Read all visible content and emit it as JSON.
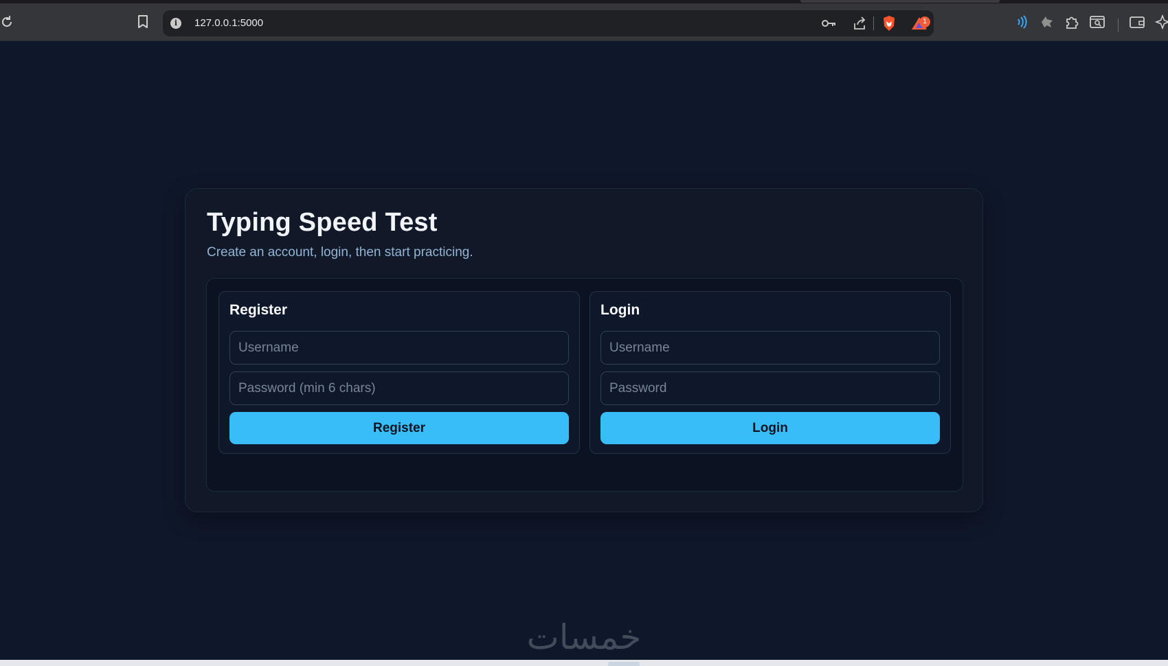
{
  "browser": {
    "url": "127.0.0.1:5000",
    "notification_count": "1",
    "icons": [
      "reload-icon",
      "bookmark-icon",
      "site-info-icon",
      "password-key-icon",
      "share-icon",
      "brave-shield-icon",
      "brave-rewards-icon",
      "speech-icon",
      "wolf-extension-icon",
      "extensions-puzzle-icon",
      "reader-mode-icon",
      "wallet-icon",
      "leo-ai-icon"
    ]
  },
  "page": {
    "title": "Typing Speed Test",
    "subtitle": "Create an account, login, then start practicing."
  },
  "register": {
    "heading": "Register",
    "username_placeholder": "Username",
    "password_placeholder": "Password (min 6 chars)",
    "button_label": "Register"
  },
  "login": {
    "heading": "Login",
    "username_placeholder": "Username",
    "password_placeholder": "Password",
    "button_label": "Login"
  },
  "watermark": {
    "text": "خمسات"
  },
  "colors": {
    "page_bg": "#0f172a",
    "card_bg": "#111827",
    "accent": "#38bdf8",
    "subtitle": "#93b4d4"
  }
}
